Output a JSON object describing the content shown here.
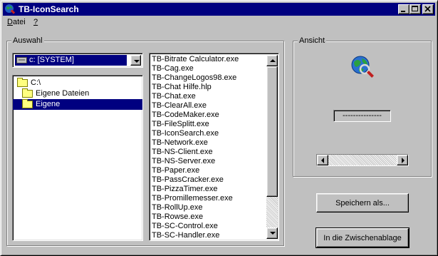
{
  "window": {
    "title": "TB-IconSearch",
    "icons": {
      "app": "globe-magnifier-icon",
      "minimize": "minimize-icon",
      "maximize": "maximize-icon",
      "close": "close-icon"
    }
  },
  "menu": [
    {
      "label": "Datei",
      "accel": "D",
      "rest": "atei"
    },
    {
      "label": "?",
      "accel": "?",
      "rest": ""
    }
  ],
  "auswahl": {
    "label": "Auswahl",
    "drive_combo": {
      "value": "c: [SYSTEM]",
      "icon": "drive-icon"
    },
    "tree": [
      {
        "label": "C:\\",
        "icon": "open-folder-icon",
        "selected": false
      },
      {
        "label": "Eigene Dateien",
        "icon": "open-folder-icon",
        "selected": false
      },
      {
        "label": "Eigene",
        "icon": "open-folder-icon",
        "selected": true
      }
    ],
    "files": [
      "TB-Bitrate Calculator.exe",
      "TB-Cag.exe",
      "TB-ChangeLogos98.exe",
      "TB-Chat Hilfe.hlp",
      "TB-Chat.exe",
      "TB-ClearAll.exe",
      "TB-CodeMaker.exe",
      "TB-FileSplitt.exe",
      "TB-IconSearch.exe",
      "TB-Network.exe",
      "TB-NS-Client.exe",
      "TB-NS-Server.exe",
      "TB-Paper.exe",
      "TB-PassCracker.exe",
      "TB-PizzaTimer.exe",
      "TB-Promillemesser.exe",
      "TB-RollUp.exe",
      "TB-Rowse.exe",
      "TB-SC-Control.exe",
      "TB-SC-Handler.exe"
    ]
  },
  "ansicht": {
    "label": "Ansicht",
    "preview_icon": "globe-magnifier-icon",
    "index_display": "---------------",
    "slider_position": 0
  },
  "buttons": {
    "save": "Speichern als...",
    "clipboard": "In die Zwischenablage"
  },
  "colors": {
    "face": "#c0c0c0",
    "titlebar": "#000080",
    "selection": "#000080"
  }
}
